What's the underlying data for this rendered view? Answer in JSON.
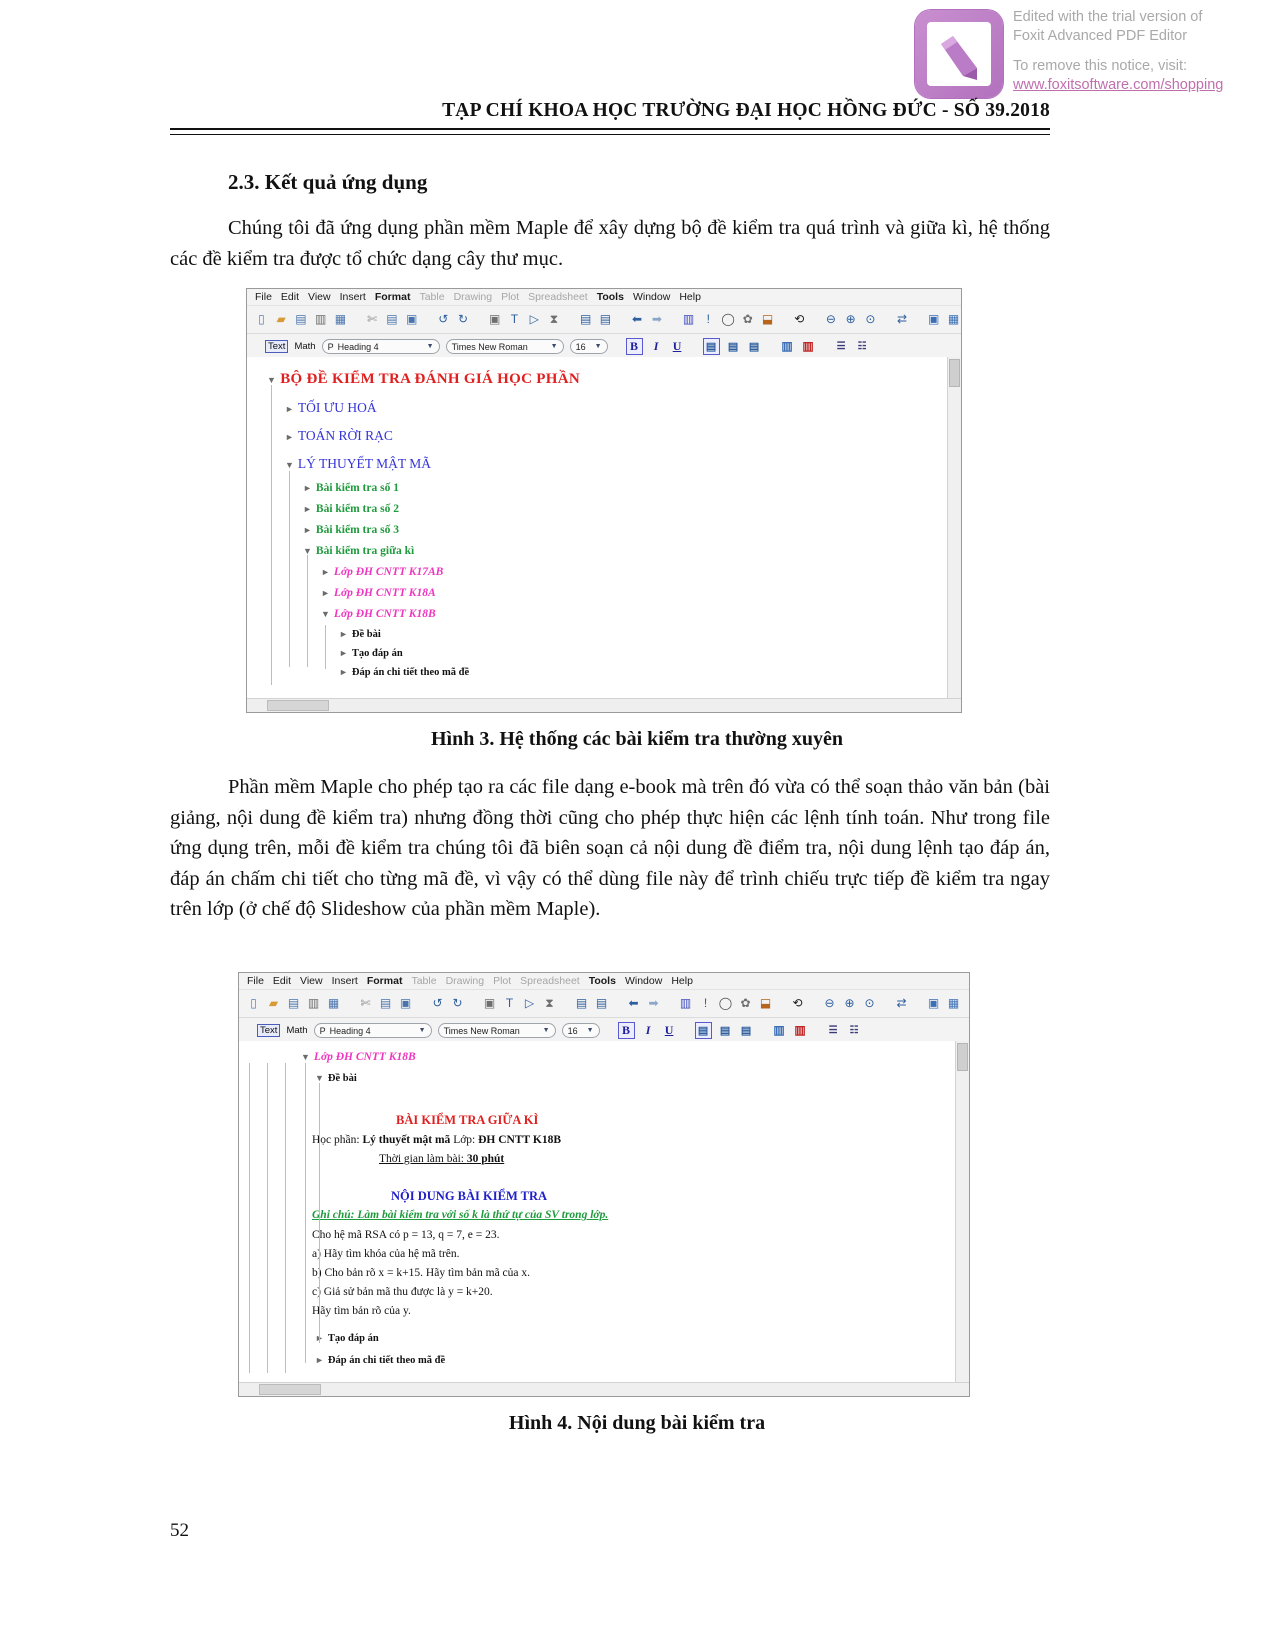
{
  "watermark": {
    "line1": "Edited with the trial version of",
    "line2": "Foxit Advanced PDF Editor",
    "line3": "To remove this notice, visit:",
    "link": "www.foxitsoftware.com/shopping"
  },
  "header": {
    "title": "TẠP CHÍ KHOA HỌC TRƯỜNG ĐẠI HỌC HỒNG ĐỨC - SỐ 39.2018"
  },
  "section": {
    "heading": "2.3. Kết quả ứng dụng",
    "paragraph1": "Chúng tôi đã ứng dụng phần mềm Maple để xây dựng bộ đề kiểm tra quá trình và giữa kì, hệ thống các đề kiểm tra được tổ chức dạng cây thư mục.",
    "paragraph2": "Phần mềm Maple cho phép tạo ra các file dạng e-book mà trên đó vừa có thể soạn thảo văn bản (bài giảng, nội dung đề kiểm tra) nhưng đồng thời cũng cho phép thực hiện các lệnh tính toán. Như trong file ứng dụng trên, mỗi đề kiểm tra chúng tôi đã biên soạn cả nội dung đề điểm tra, nội dung lệnh tạo đáp án, đáp án chấm chi tiết cho từng mã đề, vì vậy có thể dùng file này để trình chiếu trực tiếp đề kiểm tra ngay trên lớp (ở chế độ Slideshow của phần mềm Maple)."
  },
  "figure3": {
    "caption": "Hình 3. Hệ thống các bài kiểm tra thường xuyên",
    "menu": [
      {
        "label": "File",
        "enabled": true
      },
      {
        "label": "Edit",
        "enabled": true
      },
      {
        "label": "View",
        "enabled": true
      },
      {
        "label": "Insert",
        "enabled": true
      },
      {
        "label": "Format",
        "enabled": true
      },
      {
        "label": "Table",
        "enabled": false
      },
      {
        "label": "Drawing",
        "enabled": false
      },
      {
        "label": "Plot",
        "enabled": false
      },
      {
        "label": "Spreadsheet",
        "enabled": false
      },
      {
        "label": "Tools",
        "enabled": true
      },
      {
        "label": "Window",
        "enabled": true
      },
      {
        "label": "Help",
        "enabled": true
      }
    ],
    "format_bar": {
      "text_label": "Text",
      "math_label": "Math",
      "style_prefix": "P",
      "style_value": "Heading 4",
      "font_value": "Times New Roman",
      "size_value": "16",
      "bold_label": "B",
      "italic_label": "I",
      "underline_label": "U"
    },
    "tree": [
      {
        "label": "BỘ ĐỀ KIỂM TRA ĐÁNH GIÁ HỌC PHẦN",
        "level": 0,
        "color": "red",
        "state": "expanded"
      },
      {
        "label": "TỐI ƯU HOÁ",
        "level": 1,
        "color": "blue",
        "state": "collapsed"
      },
      {
        "label": "TOÁN RỜI RẠC",
        "level": 1,
        "color": "blue",
        "state": "collapsed"
      },
      {
        "label": "LÝ THUYẾT MẬT MÃ",
        "level": 1,
        "color": "blue",
        "state": "expanded"
      },
      {
        "label": "Bài kiểm tra số 1",
        "level": 2,
        "color": "green",
        "state": "collapsed"
      },
      {
        "label": "Bài kiểm tra số 2",
        "level": 2,
        "color": "green",
        "state": "collapsed"
      },
      {
        "label": "Bài kiểm tra số 3",
        "level": 2,
        "color": "green",
        "state": "collapsed"
      },
      {
        "label": "Bài kiểm tra giữa kì",
        "level": 2,
        "color": "green",
        "state": "expanded"
      },
      {
        "label": "Lớp ĐH CNTT K17AB",
        "level": 3,
        "color": "pink",
        "state": "collapsed"
      },
      {
        "label": "Lớp ĐH CNTT K18A",
        "level": 3,
        "color": "pink",
        "state": "collapsed"
      },
      {
        "label": "Lớp ĐH CNTT K18B",
        "level": 3,
        "color": "pink",
        "state": "expanded"
      },
      {
        "label": "Đề bài",
        "level": 4,
        "color": "black",
        "state": "collapsed"
      },
      {
        "label": "Tạo đáp án",
        "level": 4,
        "color": "black",
        "state": "collapsed"
      },
      {
        "label": "Đáp án chi tiết theo mã đề",
        "level": 4,
        "color": "black",
        "state": "collapsed"
      }
    ]
  },
  "figure4": {
    "caption": "Hình 4. Nội dung bài kiểm tra",
    "menu": [
      {
        "label": "File",
        "enabled": true
      },
      {
        "label": "Edit",
        "enabled": true
      },
      {
        "label": "View",
        "enabled": true
      },
      {
        "label": "Insert",
        "enabled": true
      },
      {
        "label": "Format",
        "enabled": true
      },
      {
        "label": "Table",
        "enabled": false
      },
      {
        "label": "Drawing",
        "enabled": false
      },
      {
        "label": "Plot",
        "enabled": false
      },
      {
        "label": "Spreadsheet",
        "enabled": false
      },
      {
        "label": "Tools",
        "enabled": true
      },
      {
        "label": "Window",
        "enabled": true
      },
      {
        "label": "Help",
        "enabled": true
      }
    ],
    "format_bar": {
      "text_label": "Text",
      "math_label": "Math",
      "style_prefix": "P",
      "style_value": "Heading 4",
      "font_value": "Times New Roman",
      "size_value": "16",
      "bold_label": "B",
      "italic_label": "I",
      "underline_label": "U"
    },
    "tree_top": [
      {
        "label": "Lớp ĐH CNTT K18B",
        "color": "pink",
        "state": "expanded"
      },
      {
        "label": "Đề bài",
        "color": "black",
        "state": "expanded"
      }
    ],
    "exam": {
      "title": "BÀI KIỂM TRA GIỮA KÌ",
      "course_label": "Học phần:",
      "course_value": "Lý thuyết mật mã",
      "class_label": "Lớp:",
      "class_value": "ĐH CNTT K18B",
      "duration_label": "Thời gian làm bài:",
      "duration_value": "30 phút",
      "content_heading": "NỘI DUNG BÀI KIỂM TRA",
      "note": "Ghi chú: Làm bài kiểm tra với số k là thứ tự của SV trong lớp.",
      "lines": [
        "Cho hệ mã RSA có p = 13, q = 7, e = 23.",
        "a) Hãy tìm khóa  của hệ mã trên.",
        "b) Cho bản rõ x = k+15. Hãy tìm bản mã của x.",
        "c) Giả sử bản mã thu được là y = k+20.",
        "    Hãy tìm bản rõ của y."
      ]
    },
    "tree_bottom": [
      {
        "label": "Tạo đáp án",
        "color": "black",
        "state": "collapsed"
      },
      {
        "label": "Đáp án chi tiết theo mã đề",
        "color": "black",
        "state": "collapsed"
      }
    ]
  },
  "page_number": "52"
}
